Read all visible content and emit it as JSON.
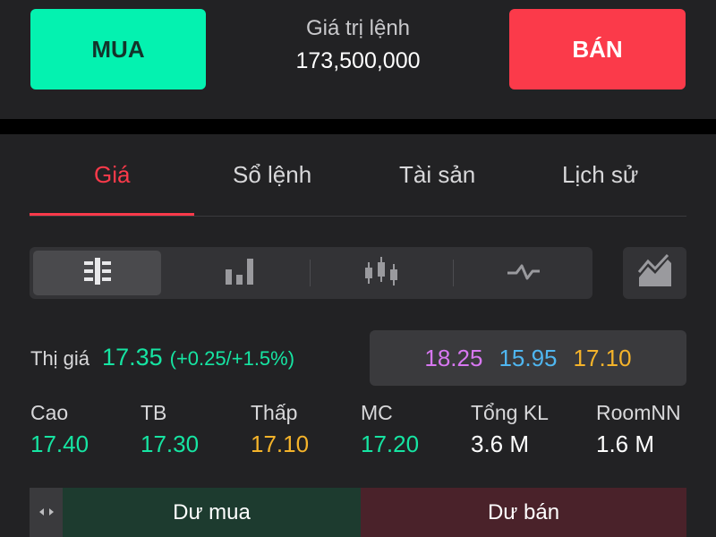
{
  "order": {
    "buy_label": "MUA",
    "sell_label": "BÁN",
    "value_label": "Giá trị lệnh",
    "value": "173,500,000"
  },
  "tabs": [
    {
      "label": "Giá",
      "active": true
    },
    {
      "label": "Sổ lệnh",
      "active": false
    },
    {
      "label": "Tài sản",
      "active": false
    },
    {
      "label": "Lịch sử",
      "active": false
    }
  ],
  "view_modes": [
    {
      "icon": "price-ladder-icon",
      "active": true
    },
    {
      "icon": "bar-chart-icon",
      "active": false
    },
    {
      "icon": "candlestick-icon",
      "active": false
    },
    {
      "icon": "line-chart-icon",
      "active": false
    }
  ],
  "area_chart_icon": "area-chart-icon",
  "market": {
    "price_label": "Thị giá",
    "price": "17.35",
    "change": "(+0.25/+1.5%)",
    "ceiling": "18.25",
    "floor": "15.95",
    "reference": "17.10"
  },
  "stats": [
    {
      "label": "Cao",
      "value": "17.40",
      "color": "#16e4a2"
    },
    {
      "label": "TB",
      "value": "17.30",
      "color": "#16e4a2"
    },
    {
      "label": "Thấp",
      "value": "17.10",
      "color": "#f4b32a"
    },
    {
      "label": "MC",
      "value": "17.20",
      "color": "#16e4a2"
    },
    {
      "label": "Tổng KL",
      "value": "3.6 M",
      "color": "#ffffff"
    },
    {
      "label": "RoomNN",
      "value": "1.6 M",
      "color": "#ffffff"
    }
  ],
  "depth": {
    "buy_label": "Dư mua",
    "sell_label": "Dư bán"
  },
  "colors": {
    "buy": "#04f2b0",
    "sell": "#fb3a4a",
    "up": "#16e4a2",
    "reference": "#f4b32a",
    "ceiling": "#d777f1",
    "floor": "#4fb6f0"
  }
}
